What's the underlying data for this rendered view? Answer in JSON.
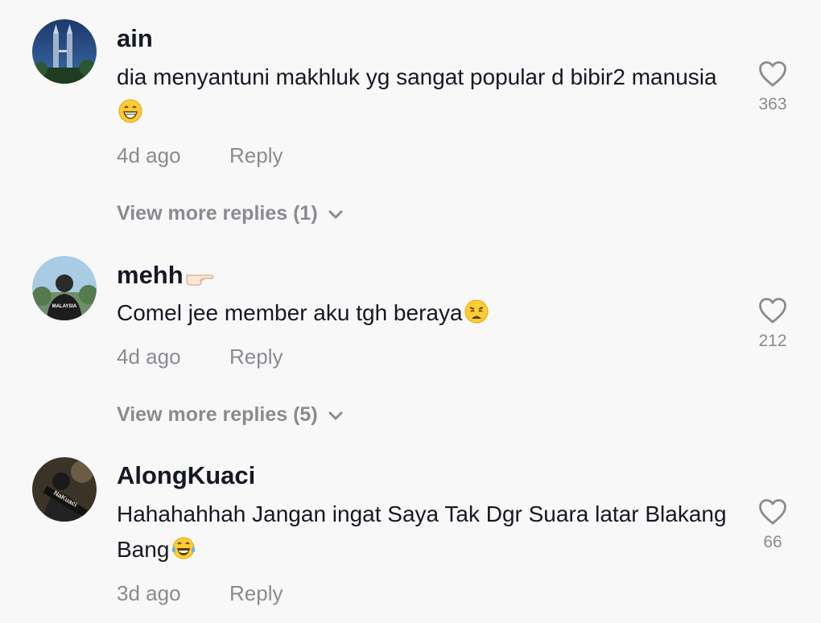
{
  "comments": [
    {
      "username": "ain",
      "text": "dia menyantuni makhluk yg sangat popular d bibir2 manusia",
      "emoji": "grinning-face-emoji",
      "time": "4d ago",
      "reply_label": "Reply",
      "likes": "363",
      "more_replies": "View more replies (1)"
    },
    {
      "username": "mehh",
      "username_emoji": "pointing-hand-emoji",
      "text": "Comel jee member aku tgh beraya",
      "emoji": "weary-face-emoji",
      "time": "4d ago",
      "reply_label": "Reply",
      "likes": "212",
      "more_replies": "View more replies (5)"
    },
    {
      "username": "AlongKuaci",
      "text": "Hahahahhah Jangan ingat Saya Tak Dgr Suara latar Blakang Bang",
      "emoji": "tears-of-joy-emoji",
      "time": "3d ago",
      "reply_label": "Reply",
      "likes": "66"
    }
  ],
  "colors": {
    "background": "#f8f8f8",
    "primary_text": "#161823",
    "secondary_text": "#8a8b91"
  },
  "icons": [
    "heart-outline-icon",
    "chevron-down-icon"
  ]
}
